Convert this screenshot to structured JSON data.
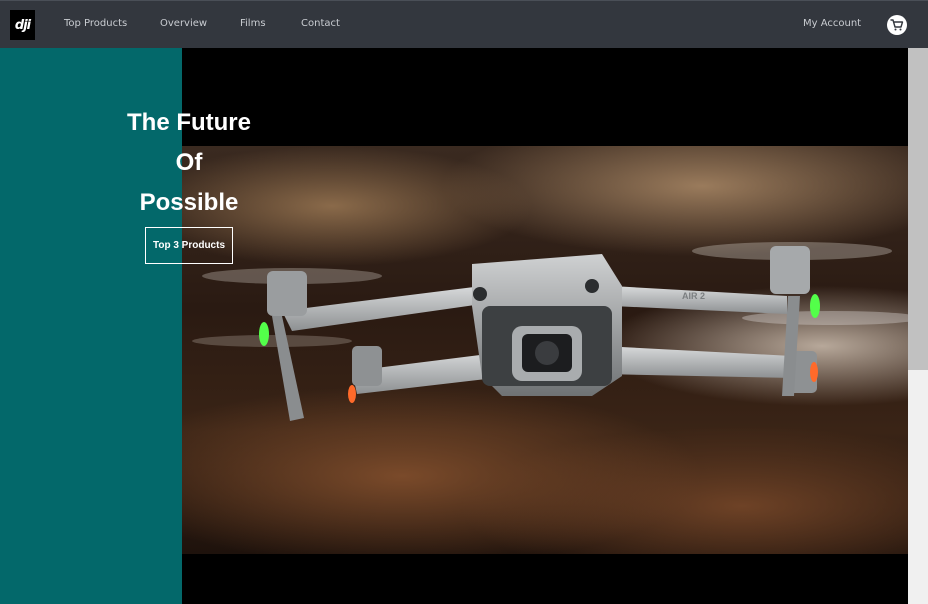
{
  "navbar": {
    "logo_text": "dji",
    "links": [
      "Top Products",
      "Overview",
      "Films",
      "Contact"
    ],
    "account_label": "My Account",
    "cart_icon": "cart-icon"
  },
  "hero": {
    "title_lines": [
      "The Future",
      "Of",
      "Possible"
    ],
    "button_label": "Top 3 Products",
    "image_alt": "drone",
    "drone_model_label": "AIR 2"
  },
  "colors": {
    "navbar_bg": "#33373e",
    "panel_teal": "#03686a",
    "hero_bg": "#000000"
  }
}
